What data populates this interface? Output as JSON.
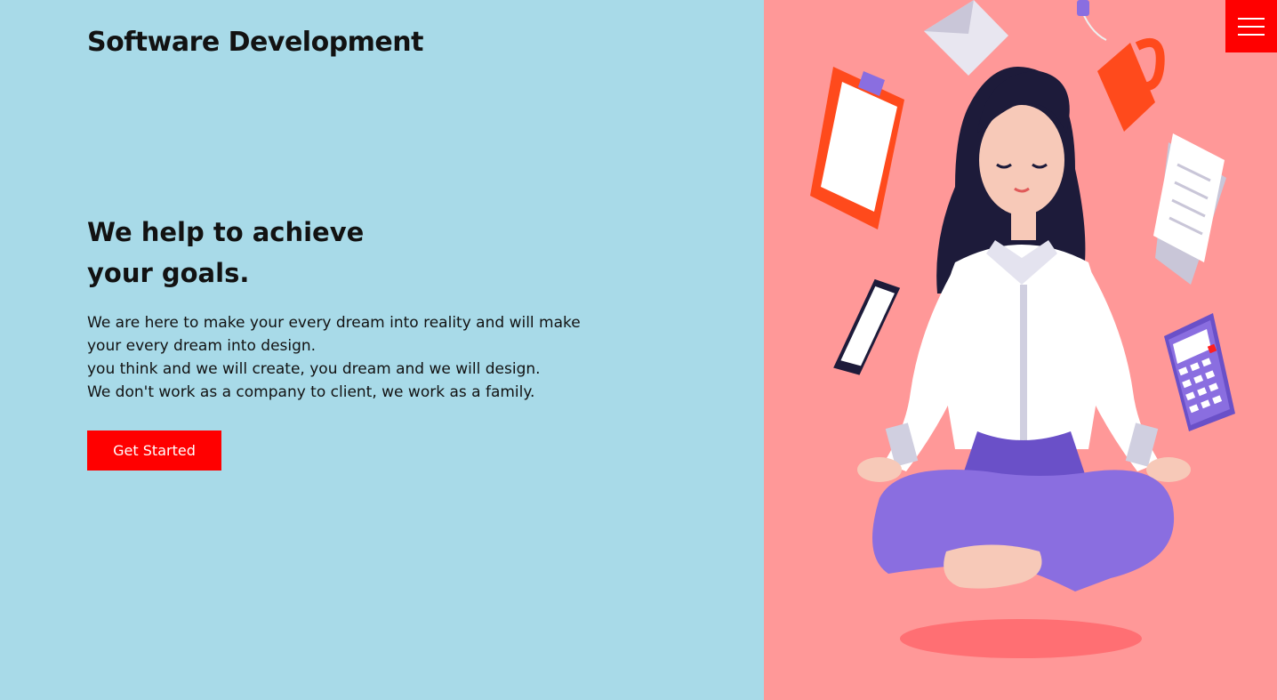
{
  "brand": {
    "title": "Software Development"
  },
  "hero": {
    "headline_line1": "We help to achieve",
    "headline_line2": "your goals.",
    "body_line1": "We are here to make your every dream into reality and will make",
    "body_line2": "your every dream into design.",
    "body_line3": "you think and we will create, you dream and we will design.",
    "body_line4": "We don't work as a company to client, we work as a family.",
    "cta_label": "Get Started"
  },
  "menu": {
    "icon": "hamburger-icon"
  },
  "illustration": {
    "icon": "meditating-woman-illustration"
  },
  "colors": {
    "left_bg": "#a8dae8",
    "right_bg": "#ff9898",
    "accent": "#ff0000",
    "purple": "#8a6ee0",
    "orange": "#ff4a1c"
  }
}
